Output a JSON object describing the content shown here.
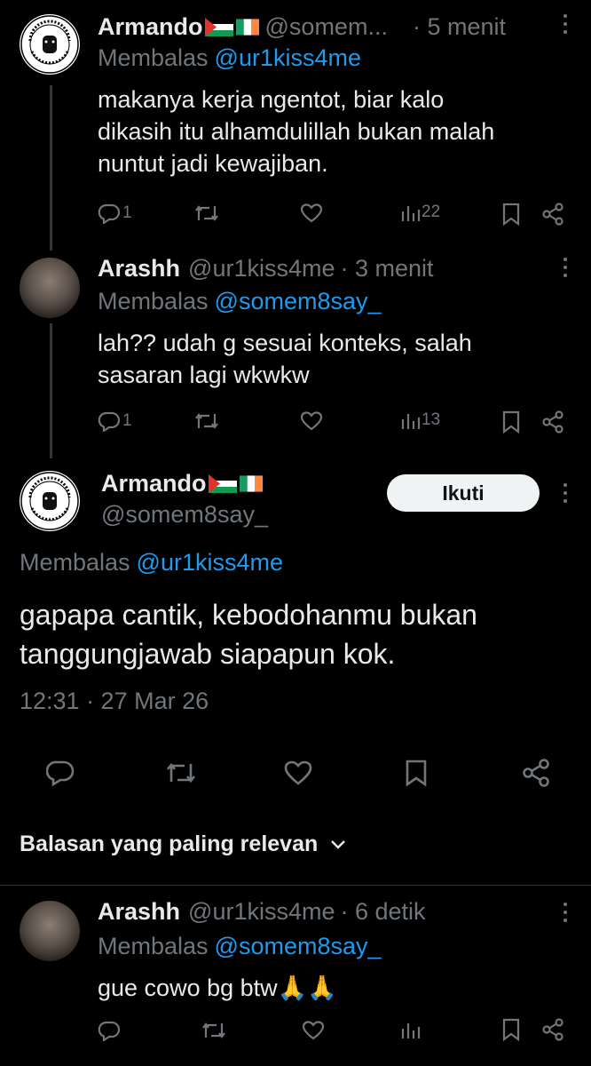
{
  "tweets": [
    {
      "name": "Armando",
      "handle": "@somem...",
      "time": "· 5 menit",
      "reply_label": "Membalas",
      "reply_to": "@ur1kiss4me",
      "text_lines": [
        "makanya kerja ngentot, biar kalo",
        "dikasih itu alhamdulillah bukan malah",
        "nuntut jadi kewajiban."
      ],
      "reply_count": "1",
      "views": "22",
      "avatar_lettering": "WE SEE THINGS THEY'LL NEVER SEE"
    },
    {
      "name": "Arashh",
      "handle": "@ur1kiss4me",
      "time": "· 3 menit",
      "reply_label": "Membalas",
      "reply_to": "@somem8say_",
      "text_lines": [
        "lah?? udah g sesuai konteks, salah",
        "sasaran lagi wkwkw"
      ],
      "reply_count": "1",
      "views": "13"
    }
  ],
  "focus": {
    "name": "Armando",
    "handle": "@somem8say_",
    "follow_label": "Ikuti",
    "reply_label": "Membalas",
    "reply_to": "@ur1kiss4me",
    "text_lines": [
      "gapapa cantik, kebodohanmu bukan",
      "tanggungjawab siapapun kok."
    ],
    "timestamp": "12:31 · 27 Mar 26"
  },
  "sort_label": "Balasan yang paling relevan",
  "last_reply": {
    "name": "Arashh",
    "handle": "@ur1kiss4me",
    "time": "· 6 detik",
    "reply_label": "Membalas",
    "reply_to": "@somem8say_",
    "text": "gue cowo bg btw🙏🙏"
  },
  "colors": {
    "background": "#000000",
    "text": "#e7e9ea",
    "muted": "#71767b",
    "link": "#1d9bf0",
    "button_bg": "#eff3f4"
  }
}
